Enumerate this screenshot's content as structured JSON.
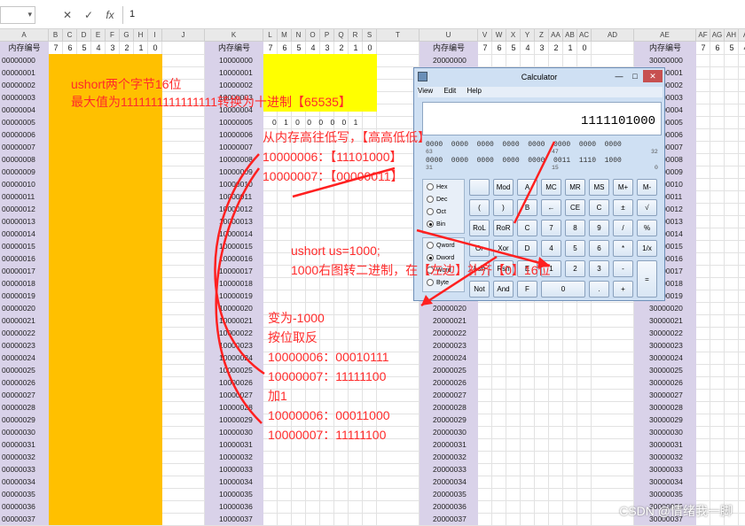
{
  "formula_bar": {
    "name_box": "",
    "cancel_icon": "✕",
    "confirm_icon": "✓",
    "fx_label": "fx",
    "formula": "1"
  },
  "columns": [
    "A",
    "B",
    "C",
    "D",
    "E",
    "F",
    "G",
    "H",
    "I",
    "J",
    "K",
    "L",
    "M",
    "N",
    "O",
    "P",
    "Q",
    "R",
    "S",
    "T",
    "U",
    "V",
    "W",
    "X",
    "Y",
    "Z",
    "AA",
    "AB",
    "AC",
    "AD",
    "AE",
    "AF",
    "AG",
    "AH",
    "A"
  ],
  "header_label": "内存编号",
  "bits": [
    "7",
    "6",
    "5",
    "4",
    "3",
    "2",
    "1",
    "0"
  ],
  "rows_a": [
    "00000000",
    "00000001",
    "00000002",
    "00000003",
    "00000004",
    "00000005",
    "00000006",
    "00000007",
    "00000008",
    "00000009",
    "00000010",
    "00000011",
    "00000012",
    "00000013",
    "00000014",
    "00000015",
    "00000016",
    "00000017",
    "00000018",
    "00000019",
    "00000020",
    "00000021",
    "00000022",
    "00000023",
    "00000024",
    "00000025",
    "00000026",
    "00000027",
    "00000028",
    "00000029",
    "00000030",
    "00000031",
    "00000032",
    "00000033",
    "00000034",
    "00000035",
    "00000036",
    "00000037"
  ],
  "rows_k": [
    "10000000",
    "10000001",
    "10000002",
    "10000003",
    "10000004",
    "10000005",
    "10000006",
    "10000007",
    "10000008",
    "10000009",
    "10000010",
    "10000011",
    "10000012",
    "10000013",
    "10000014",
    "10000015",
    "10000016",
    "10000017",
    "10000018",
    "10000019",
    "10000020",
    "10000021",
    "10000022",
    "10000023",
    "10000024",
    "10000025",
    "10000026",
    "10000027",
    "10000028",
    "10000029",
    "10000030",
    "10000031",
    "10000032",
    "10000033",
    "10000034",
    "10000035",
    "10000036",
    "10000037"
  ],
  "rows_u": [
    "20000000",
    "",
    "",
    "",
    "",
    "",
    "",
    "",
    "",
    "",
    "",
    "",
    "",
    "",
    "",
    "",
    "",
    "",
    "",
    "",
    "20000020",
    "20000021",
    "20000022",
    "20000023",
    "20000024",
    "20000025",
    "20000026",
    "20000027",
    "20000028",
    "20000029",
    "20000030",
    "20000031",
    "20000032",
    "20000033",
    "20000034",
    "20000035",
    "20000036",
    "20000037"
  ],
  "rows_ae": [
    "30000000",
    "30000001",
    "30000002",
    "30000003",
    "30000004",
    "30000005",
    "30000006",
    "30000007",
    "30000008",
    "30000009",
    "30000010",
    "30000011",
    "30000012",
    "30000013",
    "30000014",
    "30000015",
    "30000016",
    "30000017",
    "30000018",
    "30000019",
    "30000020",
    "30000021",
    "30000022",
    "30000023",
    "30000024",
    "30000025",
    "30000026",
    "30000027",
    "30000028",
    "30000029",
    "30000030",
    "30000031",
    "30000032",
    "30000033",
    "30000034",
    "30000035",
    "30000036",
    "30000037"
  ],
  "mem_bits_row": "0 1 0 0 0 0 0 1",
  "notes": {
    "n1": "ushort两个字节16位",
    "n2": "最大值为1111111111111111转换为十进制【65535】",
    "n3": "从内存高往低写，【高高低低】",
    "n4": "10000006：【11101000】",
    "n5": "10000007：【00000011】",
    "n6": "ushort us=1000;",
    "n7": "1000右图转二进制，在【左边】补齐【0】16位",
    "n8": "变为-1000",
    "n9": "按位取反",
    "n10": "10000006：00010111",
    "n11": "10000007：11111100",
    "n12": "加1",
    "n13": "10000006：00011000",
    "n14": "10000007：11111100"
  },
  "calculator": {
    "title": "Calculator",
    "menu": [
      "View",
      "Edit",
      "Help"
    ],
    "display": "1111101000",
    "bitrow1": "0000  0000  0000  0000  0000  0000  0000  0000",
    "bitrow2": "0000  0000  0000  0000  0000  0011  1110  1000",
    "bitlabels": [
      "63",
      "47",
      "32",
      "31",
      "15",
      "0"
    ],
    "radix": [
      {
        "label": "Hex",
        "on": false
      },
      {
        "label": "Dec",
        "on": false
      },
      {
        "label": "Oct",
        "on": false
      },
      {
        "label": "Bin",
        "on": true
      }
    ],
    "size": [
      {
        "label": "Qword",
        "on": false
      },
      {
        "label": "Dword",
        "on": true
      },
      {
        "label": "Word",
        "on": false
      },
      {
        "label": "Byte",
        "on": false
      }
    ],
    "buttons": [
      [
        "",
        "Mod",
        "A",
        "MC",
        "MR",
        "MS",
        "M+",
        "M-"
      ],
      [
        "(",
        ")",
        "B",
        "←",
        "CE",
        "C",
        "±",
        "√"
      ],
      [
        "RoL",
        "RoR",
        "C",
        "7",
        "8",
        "9",
        "/",
        "%"
      ],
      [
        "Or",
        "Xor",
        "D",
        "4",
        "5",
        "6",
        "*",
        "1/x"
      ],
      [
        "Lsh",
        "Rsh",
        "E",
        "1",
        "2",
        "3",
        "-",
        "="
      ],
      [
        "Not",
        "And",
        "F",
        "0",
        "",
        ".",
        "+",
        ""
      ]
    ]
  },
  "watermark": "CSDN @情绪我一脚"
}
